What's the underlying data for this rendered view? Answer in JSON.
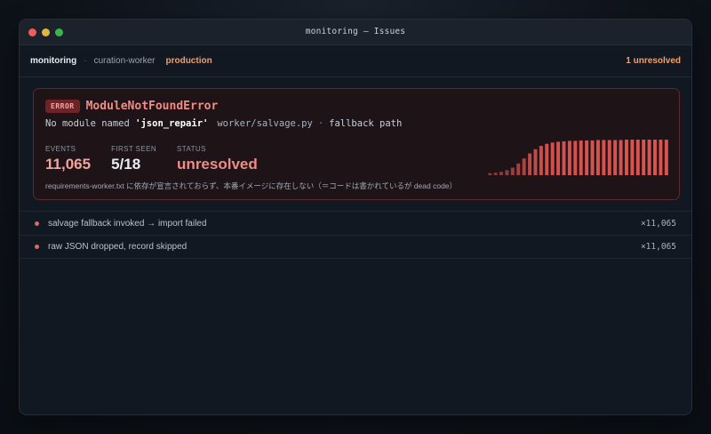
{
  "window": {
    "title": "monitoring — Issues"
  },
  "breadcrumb": {
    "project": "monitoring",
    "separator": "·",
    "service": "curation-worker",
    "environment": "production",
    "unresolved": "1 unresolved"
  },
  "issue": {
    "badge": "ERROR",
    "type": "ModuleNotFoundError",
    "message_prefix": "No module named ",
    "module": "'json_repair'",
    "file": "worker/salvage.py",
    "separator": "·",
    "context": "fallback path",
    "stats": [
      {
        "label": "EVENTS",
        "value": "11,065"
      },
      {
        "label": "FIRST SEEN",
        "value": "5/18"
      },
      {
        "label": "STATUS",
        "value": "unresolved"
      }
    ],
    "note": "requirements-worker.txt に依存が宣言されておらず、本番イメージに存在しない（＝コードは書かれているが dead code）",
    "sparkline": [
      5,
      6,
      8,
      12,
      18,
      28,
      40,
      52,
      62,
      70,
      75,
      78,
      80,
      81,
      82,
      82,
      83,
      83,
      83,
      84,
      84,
      84,
      84,
      84,
      85,
      85,
      85,
      85,
      85,
      85,
      85,
      85
    ],
    "spark_color": "#d9534f"
  },
  "events": [
    {
      "text": "salvage fallback invoked → import failed",
      "count": "×11,065"
    },
    {
      "text": "raw JSON dropped, record skipped",
      "count": "×11,065"
    }
  ]
}
